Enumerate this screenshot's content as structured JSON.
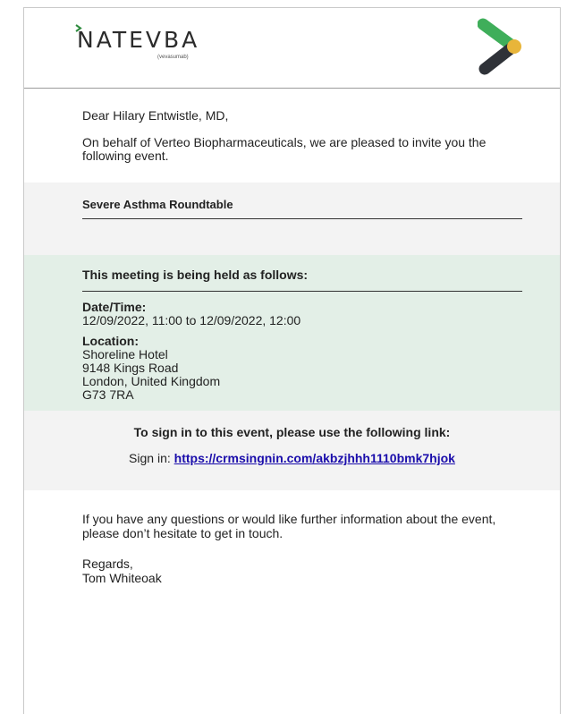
{
  "header": {
    "brand_name": "NATEVBA",
    "brand_sub": "(vevasumab)",
    "colors": {
      "brand_green": "#2e8b3e",
      "logo_green": "#3fae5a",
      "logo_dark": "#2f3238",
      "logo_yellow": "#e8b53a"
    }
  },
  "greeting": "Dear Hilary Entwistle, MD,",
  "intro": "On behalf of Verteo Biopharmaceuticals, we are pleased to invite you the following event.",
  "event": {
    "title": "Severe Asthma Roundtable"
  },
  "meeting": {
    "heading": "This meeting is being held as follows:",
    "date_label": "Date/Time:",
    "date_value": "12/09/2022, 11:00 to 12/09/2022, 12:00",
    "location_label": "Location:",
    "location_lines": [
      "Shoreline Hotel",
      "9148 Kings Road",
      "London, United Kingdom",
      "G73 7RA"
    ]
  },
  "signin": {
    "heading": "To sign in to this event, please use the following link:",
    "prefix": "Sign in:",
    "link": "https://crmsingnin.com/akbzjhhh1110bmk7hjok",
    "link_color": "#1a0dab"
  },
  "closing": {
    "text": "If you have any questions or would like further information about the event, please don’t hesitate to get in touch.",
    "regards": "Regards,",
    "signature": "Tom Whiteoak"
  }
}
